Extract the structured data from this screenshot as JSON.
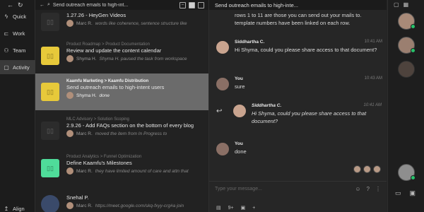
{
  "sidebar": {
    "items": [
      {
        "label": "Quick",
        "icon": "lightning-icon"
      },
      {
        "label": "Work",
        "icon": "work-icon"
      },
      {
        "label": "Team",
        "icon": "team-icon"
      },
      {
        "label": "Activity",
        "icon": "chat-icon",
        "active": true
      },
      {
        "label": "Align",
        "icon": "align-icon"
      }
    ]
  },
  "tasks_header": {
    "title": "Send outreach emails to high-int..."
  },
  "tasks": [
    {
      "crumb": "",
      "title": "1.27.26 - HeyGen Videos",
      "who": "Marc R.",
      "text": "words like coherence, sentence structure like",
      "thumb_color": "#2c2c2c"
    },
    {
      "crumb": "Product Roadmap  >  Product Documentation",
      "title": "Review and update the content calendar",
      "who": "Shyma H.",
      "text": "Shyma H. paused the task from workspace",
      "thumb_color": "#e7c93a"
    },
    {
      "crumb": "Kaamfu Marketing  >  Kaamfu Distribution",
      "title": "Send outreach emails to high-intent users",
      "who": "Shyma H.",
      "text": "done",
      "thumb_color": "#e7c93a"
    },
    {
      "crumb": "MLC Advisory  >  Solution Scoping",
      "title": "2.9.26 - Add FAQs section on the bottom of every blog",
      "who": "Marc R.",
      "text": "moved  the item from In Progress to",
      "thumb_color": "#2c2c2c"
    },
    {
      "crumb": "Product Analytics  >  Funnel Optimization",
      "title": "Define Kaamfu's Milestones",
      "who": "Marc R.",
      "text": "they have limited amount of care and attn that",
      "thumb_color": "#4fdc9a"
    },
    {
      "crumb": "",
      "title": "Snehal P.",
      "who": "Marc R.",
      "text": "https://meet.google.com/skq-fxyy-crg#a join",
      "thumb_color": "#3a4a6a"
    }
  ],
  "chat": {
    "header_title": "Send outreach emails to high-inte...",
    "system_text": "rows 1 to 11 are those you can send out your mails to. template numbers have been linked on each row.",
    "messages": [
      {
        "name": "Siddhartha C.",
        "time": "10:41 AM",
        "text": "Hi Shyma, could you please share access to that document?"
      },
      {
        "name": "You",
        "time": "10:43 AM",
        "text": "sure"
      },
      {
        "name": "Siddhartha C.",
        "time": "10:41 AM",
        "text": "Hi Shyma, could you please share access to that document?"
      },
      {
        "name": "You",
        "time": "",
        "text": "done"
      }
    ],
    "composer_placeholder": "Type your message...",
    "composer_icons": [
      "emoji-icon",
      "help-icon",
      "mic-icon"
    ]
  },
  "toolbar": {
    "items": [
      "▤",
      "9+",
      "▣",
      "+"
    ]
  },
  "rail": {
    "online_count": 3
  }
}
